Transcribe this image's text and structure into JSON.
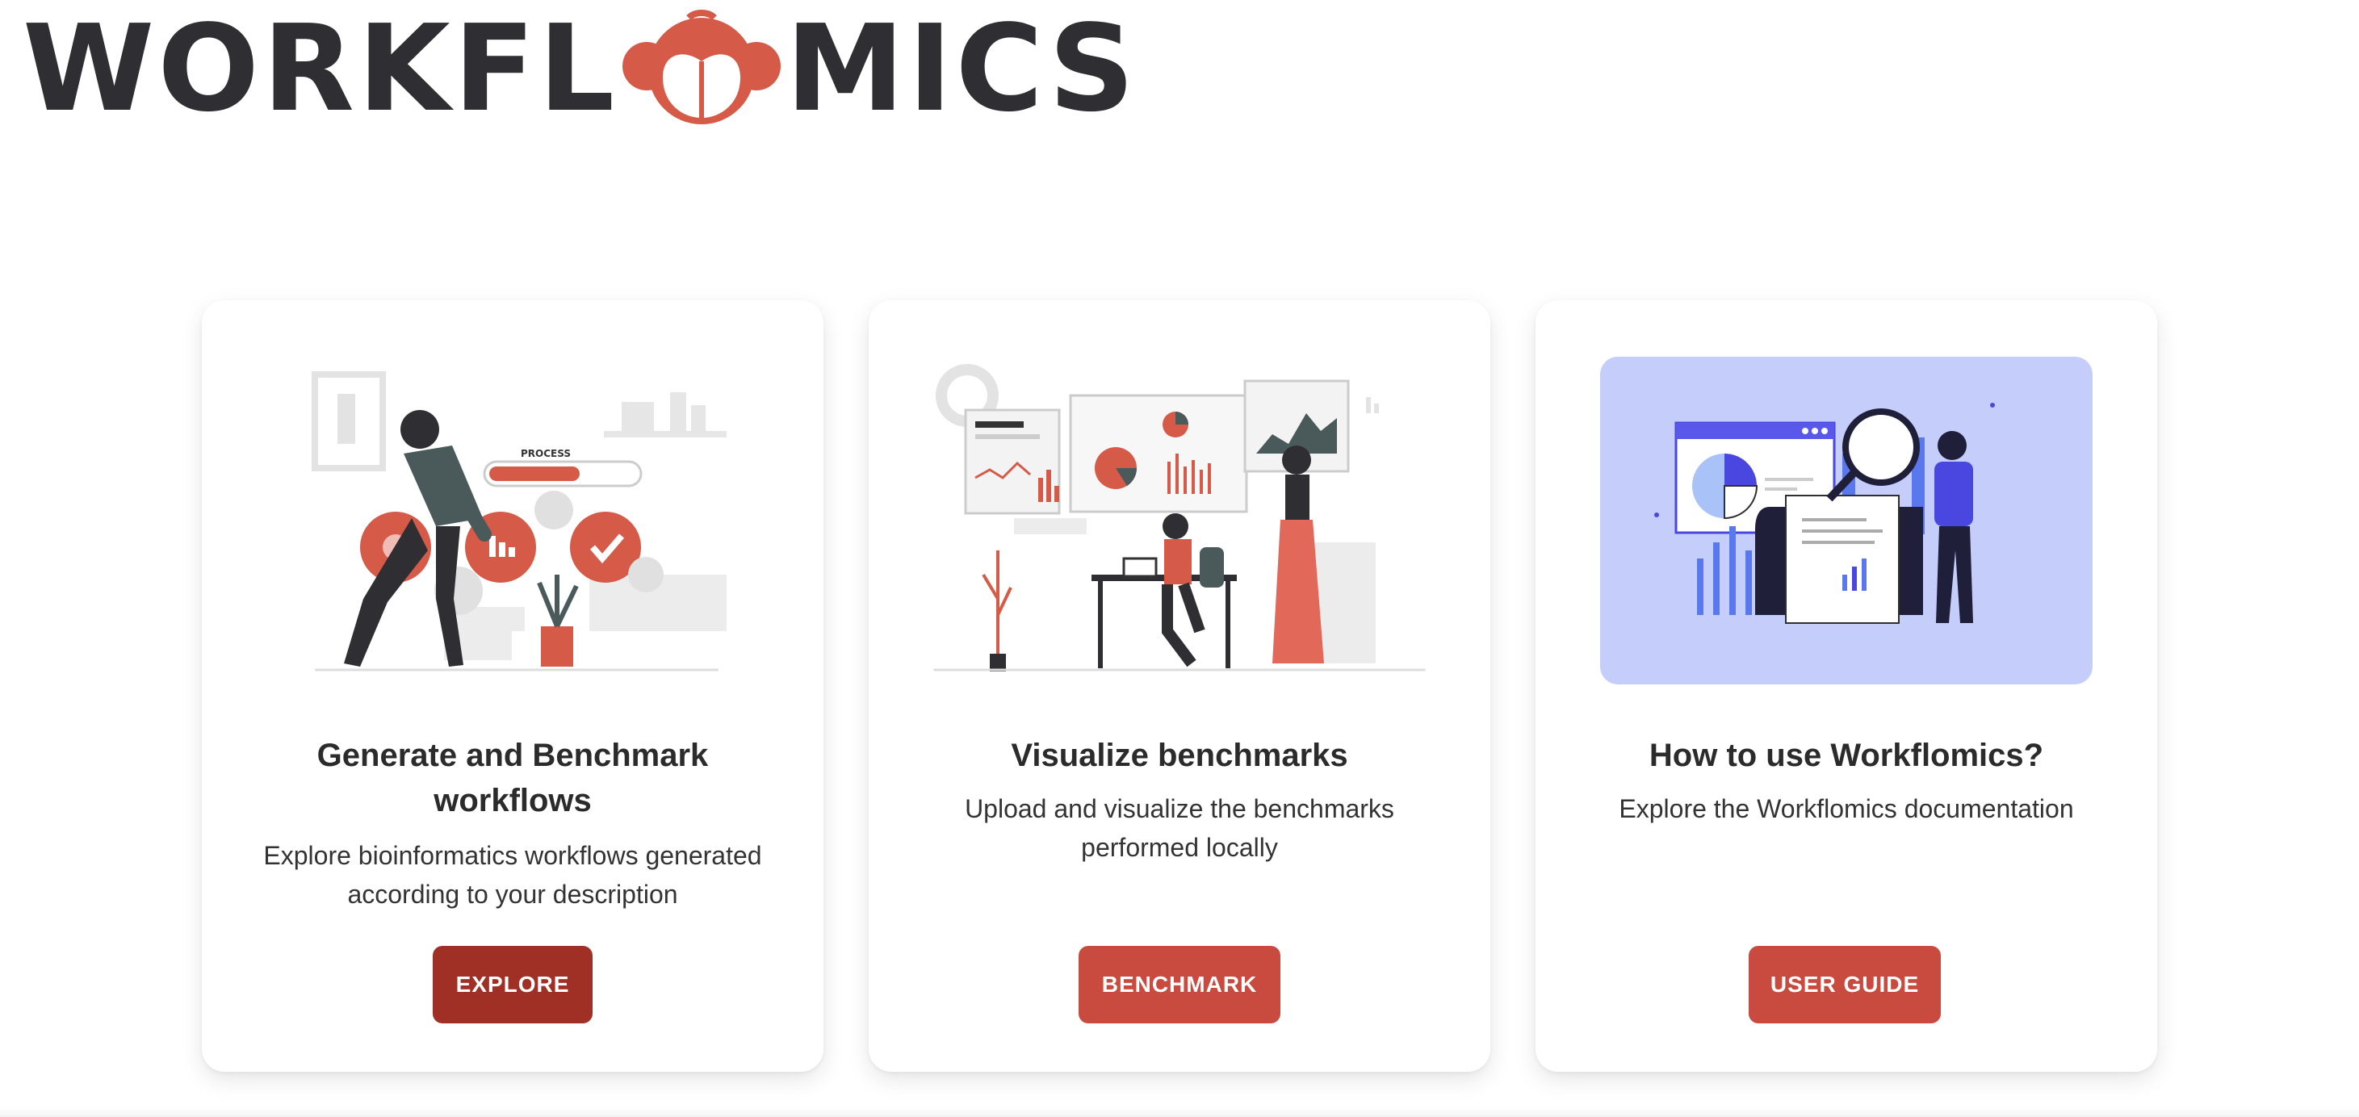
{
  "app": {
    "logo_text_left": "WORKFL",
    "logo_text_right": "MICS",
    "brand_dark": "#2e2e33",
    "brand_accent": "#d65a48"
  },
  "cards": [
    {
      "title": "Generate and Benchmark workflows",
      "description": "Explore bioinformatics workflows generated according to your description",
      "button_label": "EXPLORE",
      "button_color": "#a03026",
      "illustration": "gears-process-illustration"
    },
    {
      "title": "Visualize benchmarks",
      "description": "Upload and visualize the benchmarks performed locally",
      "button_label": "BENCHMARK",
      "button_color": "#c94a3e",
      "illustration": "dashboard-presentation-illustration"
    },
    {
      "title": "How to use Workflomics?",
      "description": "Explore the Workflomics documentation",
      "button_label": "USER GUIDE",
      "button_color": "#c94a3e",
      "illustration": "magnifier-report-illustration"
    }
  ],
  "illustration_text": {
    "process_label": "PROCESS"
  }
}
